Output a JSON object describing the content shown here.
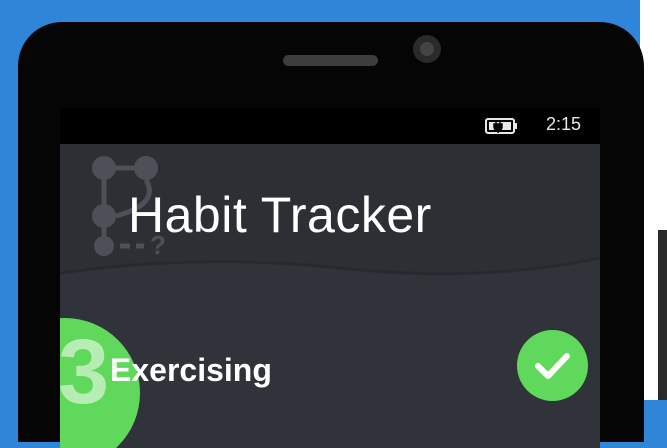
{
  "statusbar": {
    "time": "2:15",
    "battery_icon": "battery-charging-icon"
  },
  "header": {
    "title": "Habit Tracker",
    "logo_icon": "habit-tracker-logo-icon"
  },
  "habit": {
    "count": "3",
    "name": "Exercising",
    "done_icon": "checkmark-icon"
  },
  "colors": {
    "background": "#2f86d8",
    "accent_green": "#5fd85b",
    "screen": "#30343a",
    "header": "#2c3035"
  }
}
